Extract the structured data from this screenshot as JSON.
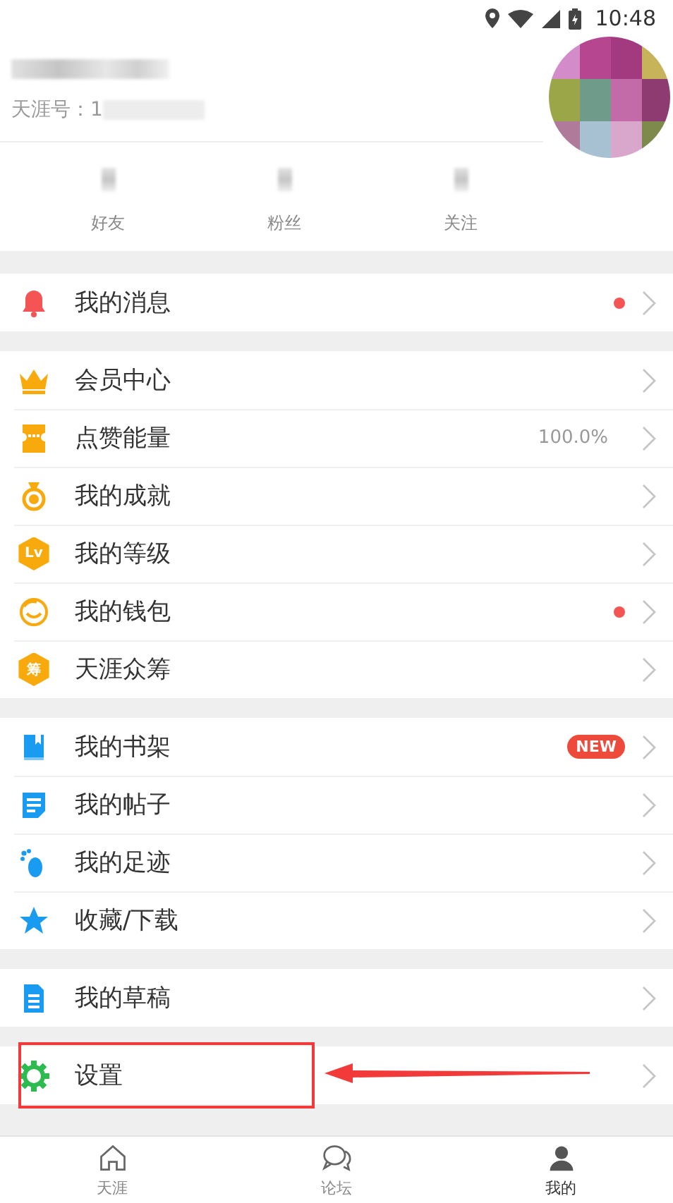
{
  "status_bar": {
    "time": "10:48"
  },
  "profile": {
    "id_label": "天涯号：1",
    "stats": [
      {
        "label": "好友"
      },
      {
        "label": "粉丝"
      },
      {
        "label": "关注"
      }
    ]
  },
  "sections": [
    {
      "items": [
        {
          "label": "我的消息",
          "unread": true,
          "highlighted": false
        }
      ]
    },
    {
      "items": [
        {
          "label": "会员中心",
          "unread": false,
          "highlighted": false
        },
        {
          "label": "点赞能量",
          "value": "100.0%",
          "unread": false,
          "highlighted": false
        },
        {
          "label": "我的成就",
          "unread": false,
          "highlighted": false
        },
        {
          "label": "我的等级",
          "icon_label": "Lv",
          "unread": false,
          "highlighted": false
        },
        {
          "label": "我的钱包",
          "unread": true,
          "highlighted": false
        },
        {
          "label": "天涯众筹",
          "icon_label": "筹",
          "unread": false,
          "highlighted": false
        }
      ]
    },
    {
      "items": [
        {
          "label": "我的书架",
          "badge": "NEW",
          "unread": false,
          "highlighted": false
        },
        {
          "label": "我的帖子",
          "unread": false,
          "highlighted": false
        },
        {
          "label": "我的足迹",
          "unread": false,
          "highlighted": false
        },
        {
          "label": "收藏/下载",
          "unread": false,
          "highlighted": false
        }
      ]
    },
    {
      "items": [
        {
          "label": "我的草稿",
          "unread": false,
          "highlighted": false
        }
      ]
    },
    {
      "items": [
        {
          "label": "设置",
          "unread": false,
          "highlighted": true
        }
      ]
    }
  ],
  "tab_bar": [
    {
      "label": "天涯",
      "selected": false
    },
    {
      "label": "论坛",
      "selected": false
    },
    {
      "label": "我的",
      "selected": true
    }
  ]
}
